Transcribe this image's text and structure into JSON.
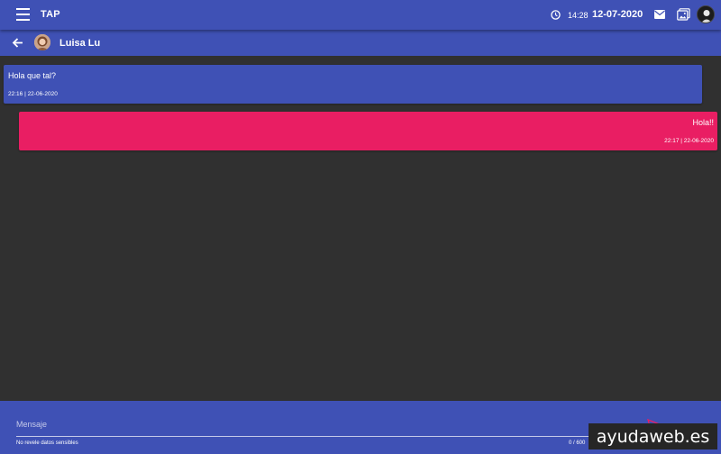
{
  "header": {
    "app_title": "TAP",
    "time": "14:28",
    "date": "12-07-2020"
  },
  "chat": {
    "contact_name": "Luisa Lu",
    "messages": [
      {
        "text": "Hola que tal?",
        "timestamp": "22:16 | 22-06-2020",
        "direction": "incoming"
      },
      {
        "text": "Hola!!",
        "timestamp": "22:17 | 22-06-2020",
        "direction": "outgoing"
      }
    ]
  },
  "compose": {
    "placeholder": "Mensaje",
    "value": "",
    "hint": "No revele datos sensibles",
    "counter": "0 / 600"
  },
  "watermark": "ayudaweb.es",
  "colors": {
    "primary": "#3f51b5",
    "accent": "#e91e63",
    "background": "#303030"
  }
}
